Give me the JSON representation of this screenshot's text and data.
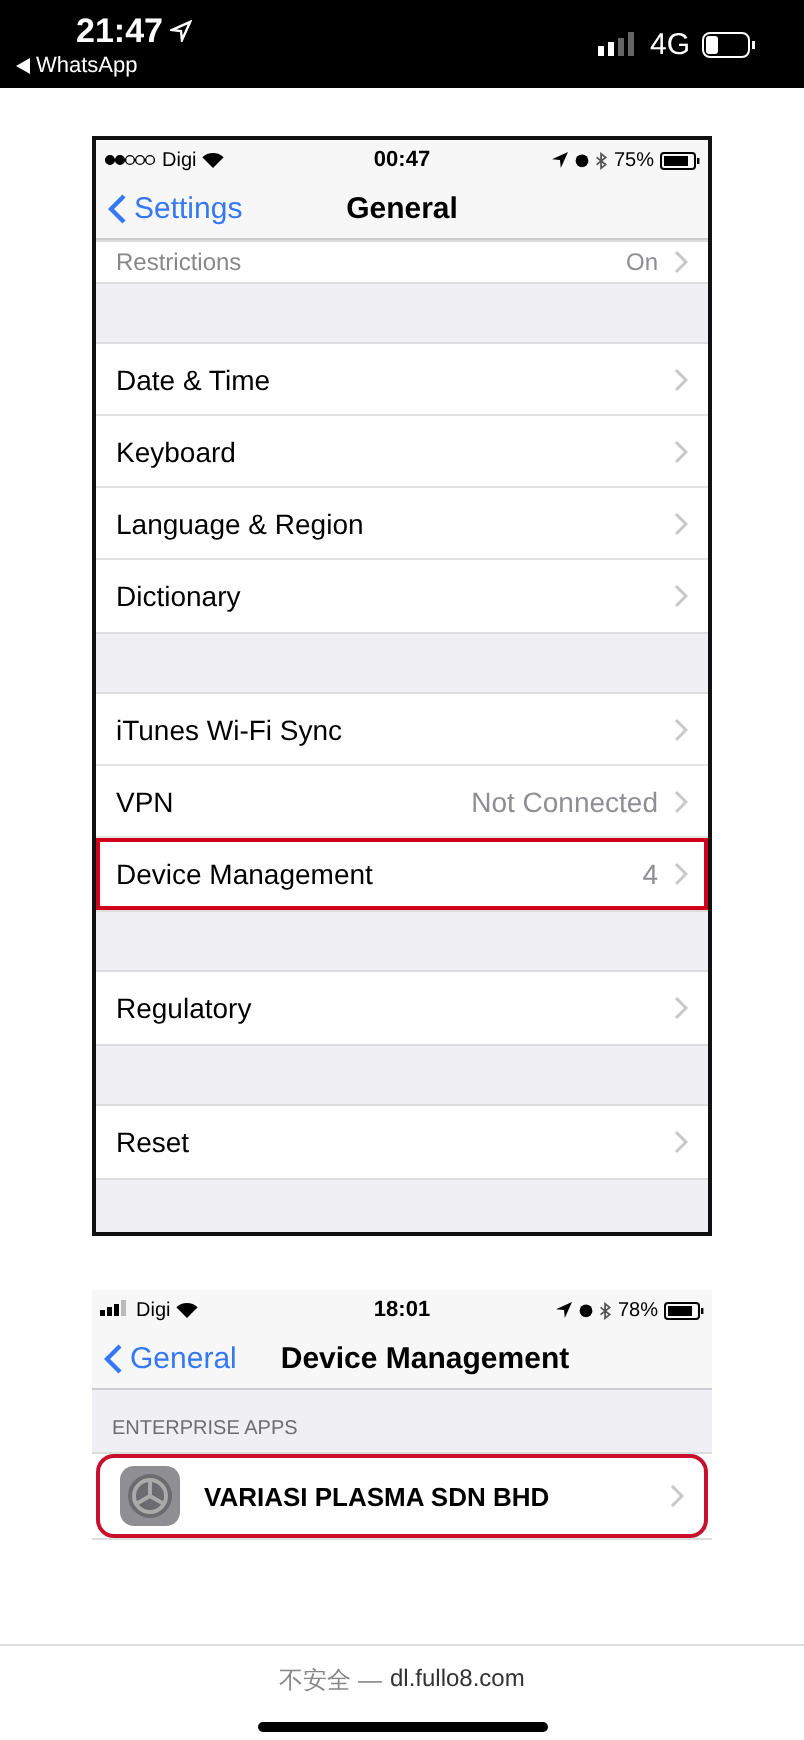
{
  "status_bar": {
    "time": "21:47",
    "back_app": "WhatsApp",
    "network": "4G"
  },
  "screenshots": [
    {
      "status": {
        "carrier": "Digi",
        "kind": "dots",
        "time": "00:47",
        "battery": "75%"
      },
      "nav": {
        "back": "Settings",
        "title": "General"
      },
      "bordered": true,
      "groups": [
        {
          "rows": [
            {
              "label": "Restrictions",
              "value": "On",
              "highlighted": false,
              "kind": "cut"
            }
          ]
        },
        {
          "rows": [
            {
              "label": "Date & Time",
              "highlighted": false,
              "kind": "plain"
            },
            {
              "label": "Keyboard",
              "highlighted": false,
              "kind": "plain"
            },
            {
              "label": "Language & Region",
              "highlighted": false,
              "kind": "plain"
            },
            {
              "label": "Dictionary",
              "highlighted": false,
              "kind": "plain"
            }
          ]
        },
        {
          "rows": [
            {
              "label": "iTunes Wi-Fi Sync",
              "highlighted": false,
              "kind": "plain"
            },
            {
              "label": "VPN",
              "value": "Not Connected",
              "highlighted": false,
              "kind": "plain"
            },
            {
              "label": "Device Management",
              "value": "4",
              "highlighted": true,
              "kind": "plain"
            }
          ]
        },
        {
          "rows": [
            {
              "label": "Regulatory",
              "highlighted": false,
              "kind": "plain"
            }
          ]
        },
        {
          "rows": [
            {
              "label": "Reset",
              "highlighted": false,
              "kind": "plain"
            }
          ]
        }
      ]
    },
    {
      "status": {
        "carrier": "Digi",
        "kind": "bars",
        "time": "18:01",
        "battery": "78%"
      },
      "nav": {
        "back": "General",
        "title": "Device Management"
      },
      "bordered": false,
      "groups": [
        {
          "header": "ENTERPRISE APPS",
          "rows": [
            {
              "label": "VARIASI PLASMA SDN BHD",
              "highlighted": true,
              "kind": "app"
            }
          ]
        }
      ]
    }
  ],
  "browser": {
    "security": "不安全 —",
    "url": "dl.fullo8.com"
  }
}
